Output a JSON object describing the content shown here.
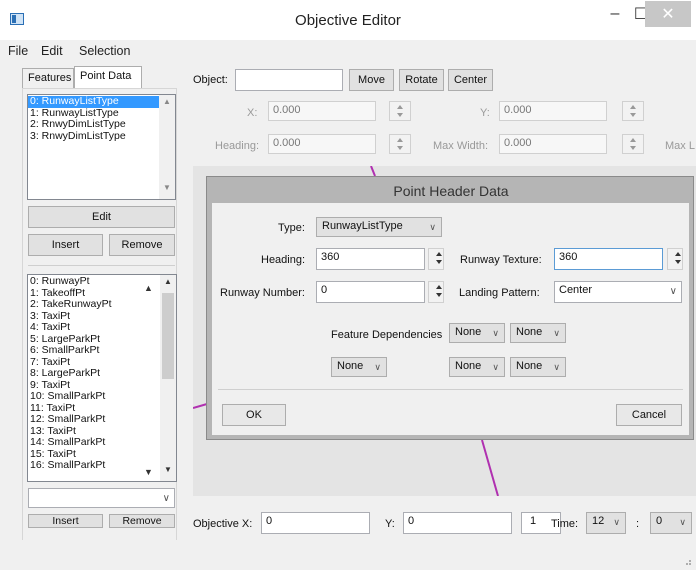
{
  "window": {
    "title": "Objective Editor",
    "minimize": "–",
    "maximize": "☐",
    "close": "✕"
  },
  "menu": [
    "File",
    "Edit",
    "Selection"
  ],
  "left": {
    "tabs": [
      "Features",
      "Point Data"
    ],
    "feature_list": [
      "0: RunwayListType",
      "1: RunwayListType",
      "2: RnwyDimListType",
      "3: RnwyDimListType"
    ],
    "edit_button": "Edit",
    "insert_button": "Insert",
    "remove_button": "Remove",
    "point_list": [
      "0: RunwayPt",
      "1: TakeoffPt",
      "2: TakeRunwayPt",
      "3: TaxiPt",
      "4: TaxiPt",
      "5: LargeParkPt",
      "6: SmallParkPt",
      "7: TaxiPt",
      "8: LargeParkPt",
      "9: TaxiPt",
      "10: SmallParkPt",
      "11: TaxiPt",
      "12: SmallParkPt",
      "13: TaxiPt",
      "14: SmallParkPt",
      "15: TaxiPt",
      "16: SmallParkPt"
    ],
    "insert_button2": "Insert",
    "remove_button2": "Remove"
  },
  "object_row": {
    "label": "Object:",
    "value": "",
    "move": "Move",
    "rotate": "Rotate",
    "center": "Center"
  },
  "coords": {
    "x_label": "X:",
    "x_value": "0.000",
    "y_label": "Y:",
    "y_value": "0.000",
    "heading_label": "Heading:",
    "heading_value": "0.000",
    "maxwidth_label": "Max Width:",
    "maxwidth_value": "0.000",
    "maxl_label": "Max L"
  },
  "dialog": {
    "title": "Point Header Data",
    "type_label": "Type:",
    "type_value": "RunwayListType",
    "heading_label": "Heading:",
    "heading_value": "360",
    "runway_texture_label": "Runway Texture:",
    "runway_texture_value": "360",
    "runway_number_label": "Runway Number:",
    "runway_number_value": "0",
    "landing_pattern_label": "Landing Pattern:",
    "landing_pattern_value": "Center",
    "feature_dependencies_label": "Feature Dependencies",
    "dep_values": [
      "None",
      "None",
      "None",
      "None",
      "None"
    ],
    "ok": "OK",
    "cancel": "Cancel"
  },
  "bottom": {
    "objx_label": "Objective X:",
    "objx_value": "0",
    "y_label": "Y:",
    "y_value": "0",
    "counter": "1",
    "time_label": "Time:",
    "time_hours": "12",
    "colon": ":",
    "time_minutes": "0"
  },
  "colors": {
    "selection": "#3399ff",
    "window_bg": "#f0f0f0",
    "dialog_frame": "#b5b5b5",
    "map_line": "#b030b0"
  }
}
